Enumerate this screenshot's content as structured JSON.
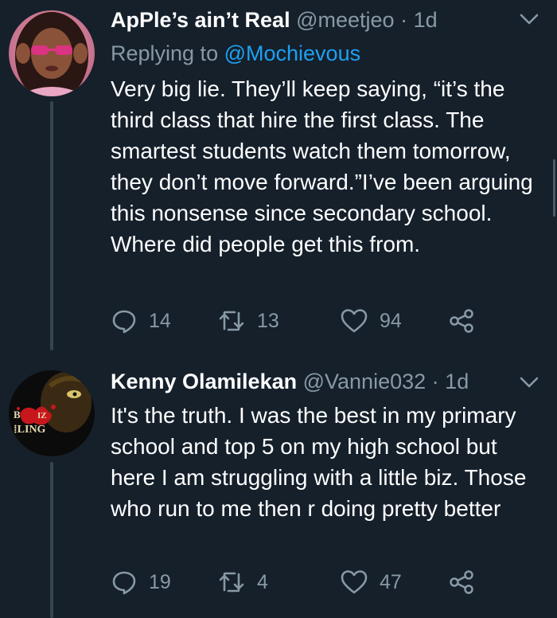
{
  "tweets": [
    {
      "author_name": "ApPle’s ain’t Real",
      "handle": "@meetjeo",
      "separator": "·",
      "time": "1d",
      "replying_prefix": "Replying to",
      "replying_to": "@Mochievous",
      "text": "Very big lie. They’ll keep saying, “it’s the third class that hire the first class. The smartest students watch them tomorrow, they don’t move forward.”I’ve been arguing this nonsense since secondary school. Where did people get this from.",
      "replies": "14",
      "retweets": "13",
      "likes": "94"
    },
    {
      "author_name": "Kenny Olamilekan",
      "handle": "@Vannie032",
      "separator": "·",
      "time": "1d",
      "text": "It's the truth. I was the best in my primary school and top 5 on my high school but here I am struggling with a little biz. Those who run to me then r doing pretty better",
      "replies": "19",
      "retweets": "4",
      "likes": "47",
      "avatar_logo_text": "BIZ BUILDING"
    }
  ],
  "icons": {
    "reply": "reply-icon",
    "retweet": "retweet-icon",
    "like": "heart-icon",
    "share": "share-icon",
    "more": "chevron-down-icon"
  },
  "colors": {
    "background": "#15202b",
    "primary_text": "#ffffff",
    "secondary_text": "#8899a6",
    "link": "#1da1f2",
    "thread_line": "#38444d"
  }
}
